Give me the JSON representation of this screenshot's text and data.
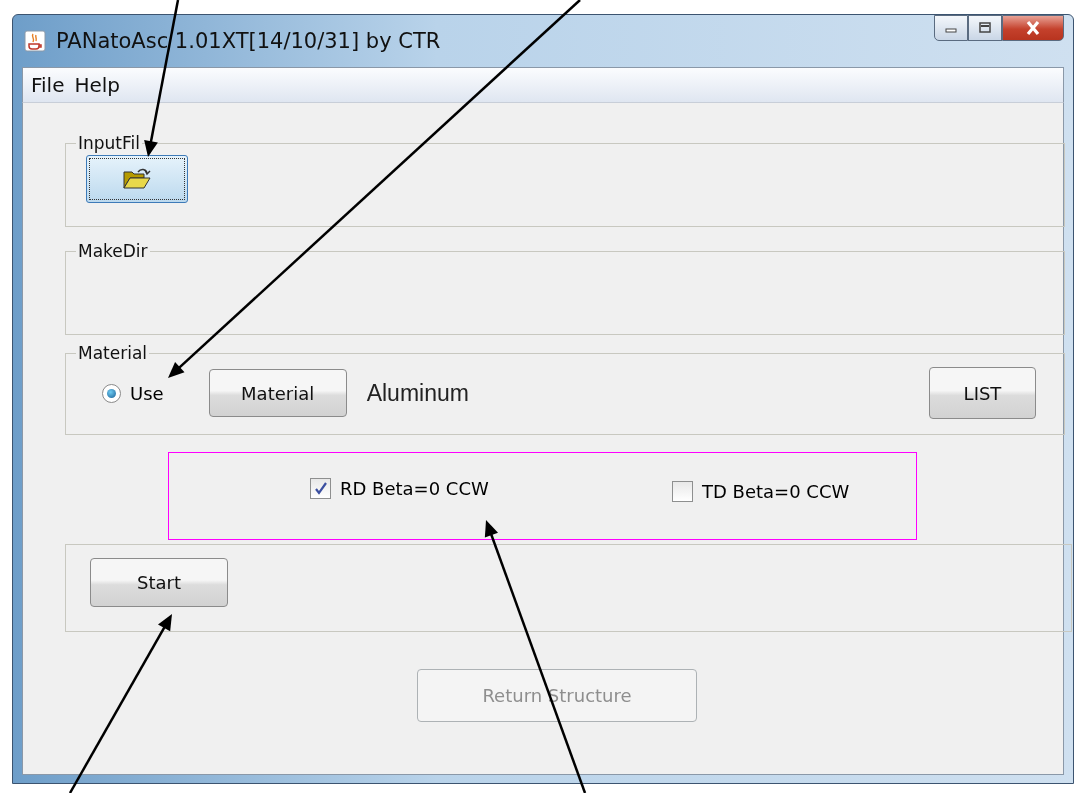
{
  "window": {
    "title": "PANatoAsc 1.01XT[14/10/31] by CTR"
  },
  "menu": [
    "File",
    "Help"
  ],
  "input_file": {
    "label": "InputFil"
  },
  "make_dir": {
    "label": "MakeDir"
  },
  "material": {
    "label": "Material",
    "radio": {
      "label": "Use",
      "selected": true
    },
    "button": "Material",
    "value": "Aluminum",
    "list_button": "LIST"
  },
  "options": [
    {
      "label": "RD Beta=0 CCW",
      "checked": true
    },
    {
      "label": "TD Beta=0 CCW",
      "checked": false
    }
  ],
  "start_button": "Start",
  "return_button": {
    "label": "Return Structure",
    "disabled": true
  }
}
